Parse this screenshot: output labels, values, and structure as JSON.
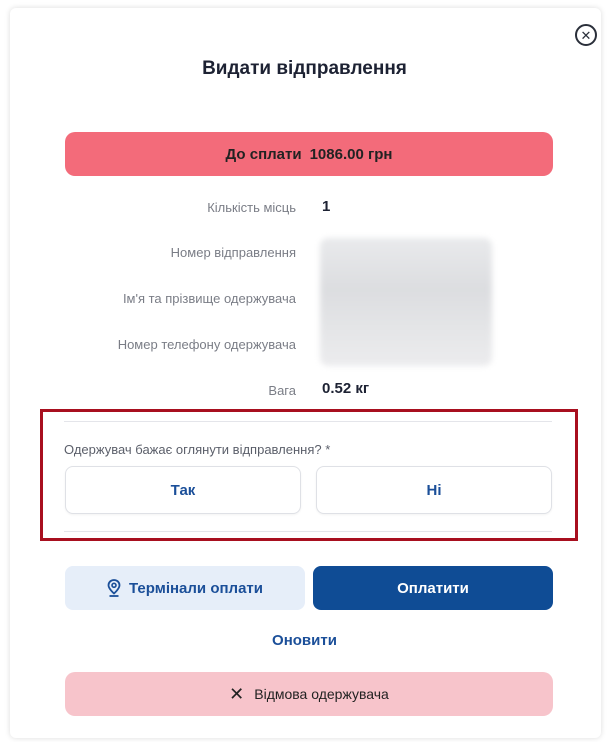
{
  "modal": {
    "title": "Видати відправлення",
    "close_icon": "close-circle-icon"
  },
  "payment": {
    "label": "До сплати",
    "amount": "1086.00 грн",
    "color": "#f36b7a"
  },
  "details": {
    "places_label": "Кількість місць",
    "places_value": "1",
    "shipment_number_label": "Номер відправлення",
    "recipient_name_label": "Ім'я та прізвище одержувача",
    "recipient_phone_label": "Номер телефону одержувача",
    "weight_label": "Вага",
    "weight_value": "0.52 кг"
  },
  "inspection": {
    "question": "Одержувач бажає оглянути відправлення? *",
    "yes_label": "Так",
    "no_label": "Ні",
    "highlight_color": "#a80f1f"
  },
  "actions": {
    "terminals_label": "Термінали оплати",
    "terminals_icon": "location-pin-icon",
    "pay_label": "Оплатити",
    "refresh_label": "Оновити",
    "refuse_label": "Відмова одержувача",
    "refuse_icon": "x-icon",
    "primary_color": "#0f4c95"
  }
}
